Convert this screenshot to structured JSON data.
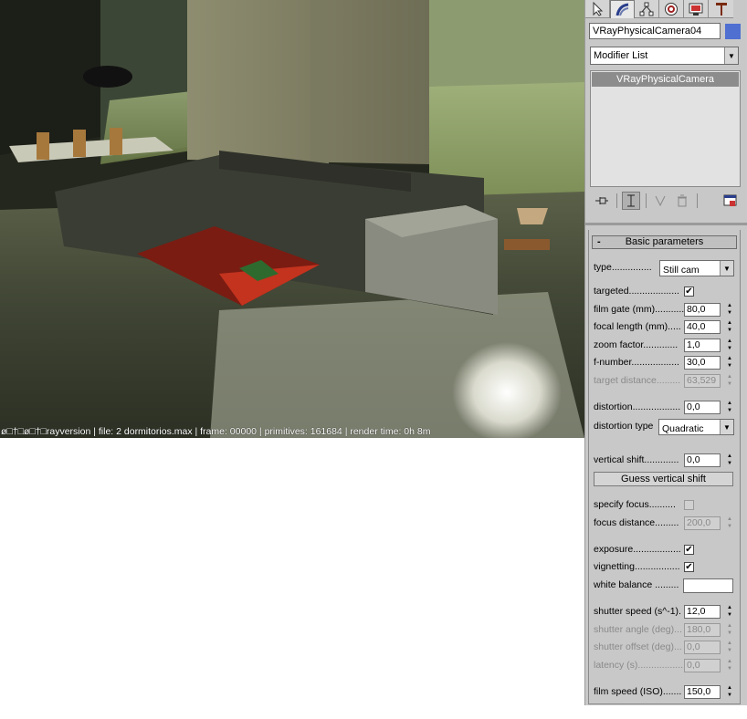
{
  "render": {
    "status_text": "ø□†□ø□†□rayversion | file: 2 dormitorios.max | frame: 00000 | primitives: 161684 | render time: 0h 8m"
  },
  "panel": {
    "tabs": [
      {
        "icon": "create-pointer-icon"
      },
      {
        "icon": "modify-icon"
      },
      {
        "icon": "hierarchy-icon"
      },
      {
        "icon": "motion-icon"
      },
      {
        "icon": "display-icon"
      },
      {
        "icon": "utilities-icon"
      }
    ],
    "object_name": "VRayPhysicalCamera04",
    "object_color": "#4f6fd1",
    "modifier_list_label": "Modifier List",
    "stack_item": "VRayPhysicalCamera",
    "rollout": {
      "title": "Basic parameters",
      "collapse_symbol": "-",
      "type_label": "type...............",
      "type_value": "Still cam",
      "targeted_label": "targeted...................",
      "targeted_checked": "✔",
      "film_gate_label": "film gate (mm)...........",
      "film_gate_value": "80,0",
      "focal_length_label": "focal length (mm).....",
      "focal_length_value": "40,0",
      "zoom_factor_label": "zoom factor.............",
      "zoom_factor_value": "1,0",
      "f_number_label": "f-number..................",
      "f_number_value": "30,0",
      "target_distance_label": "target distance.........",
      "target_distance_value": "63,529",
      "distortion_label": "distortion..................",
      "distortion_value": "0,0",
      "distortion_type_label": "distortion type",
      "distortion_type_value": "Quadratic",
      "vertical_shift_label": "vertical shift.............",
      "vertical_shift_value": "0,0",
      "guess_vertical_shift": "Guess vertical shift",
      "specify_focus_label": "specify focus..........",
      "focus_distance_label": "focus distance.........",
      "focus_distance_value": "200,0",
      "exposure_label": "exposure..................",
      "exposure_checked": "✔",
      "vignetting_label": "vignetting.................",
      "vignetting_checked": "✔",
      "white_balance_label": "white balance .........",
      "white_balance_color": "#ffffff",
      "shutter_speed_label": "shutter speed (s^-1).",
      "shutter_speed_value": "12,0",
      "shutter_angle_label": "shutter angle (deg)...",
      "shutter_angle_value": "180,0",
      "shutter_offset_label": "shutter offset (deg)...",
      "shutter_offset_value": "0,0",
      "latency_label": "latency (s)..................",
      "latency_value": "0,0",
      "film_speed_label": "film speed (ISO).......",
      "film_speed_value": "150,0"
    }
  }
}
